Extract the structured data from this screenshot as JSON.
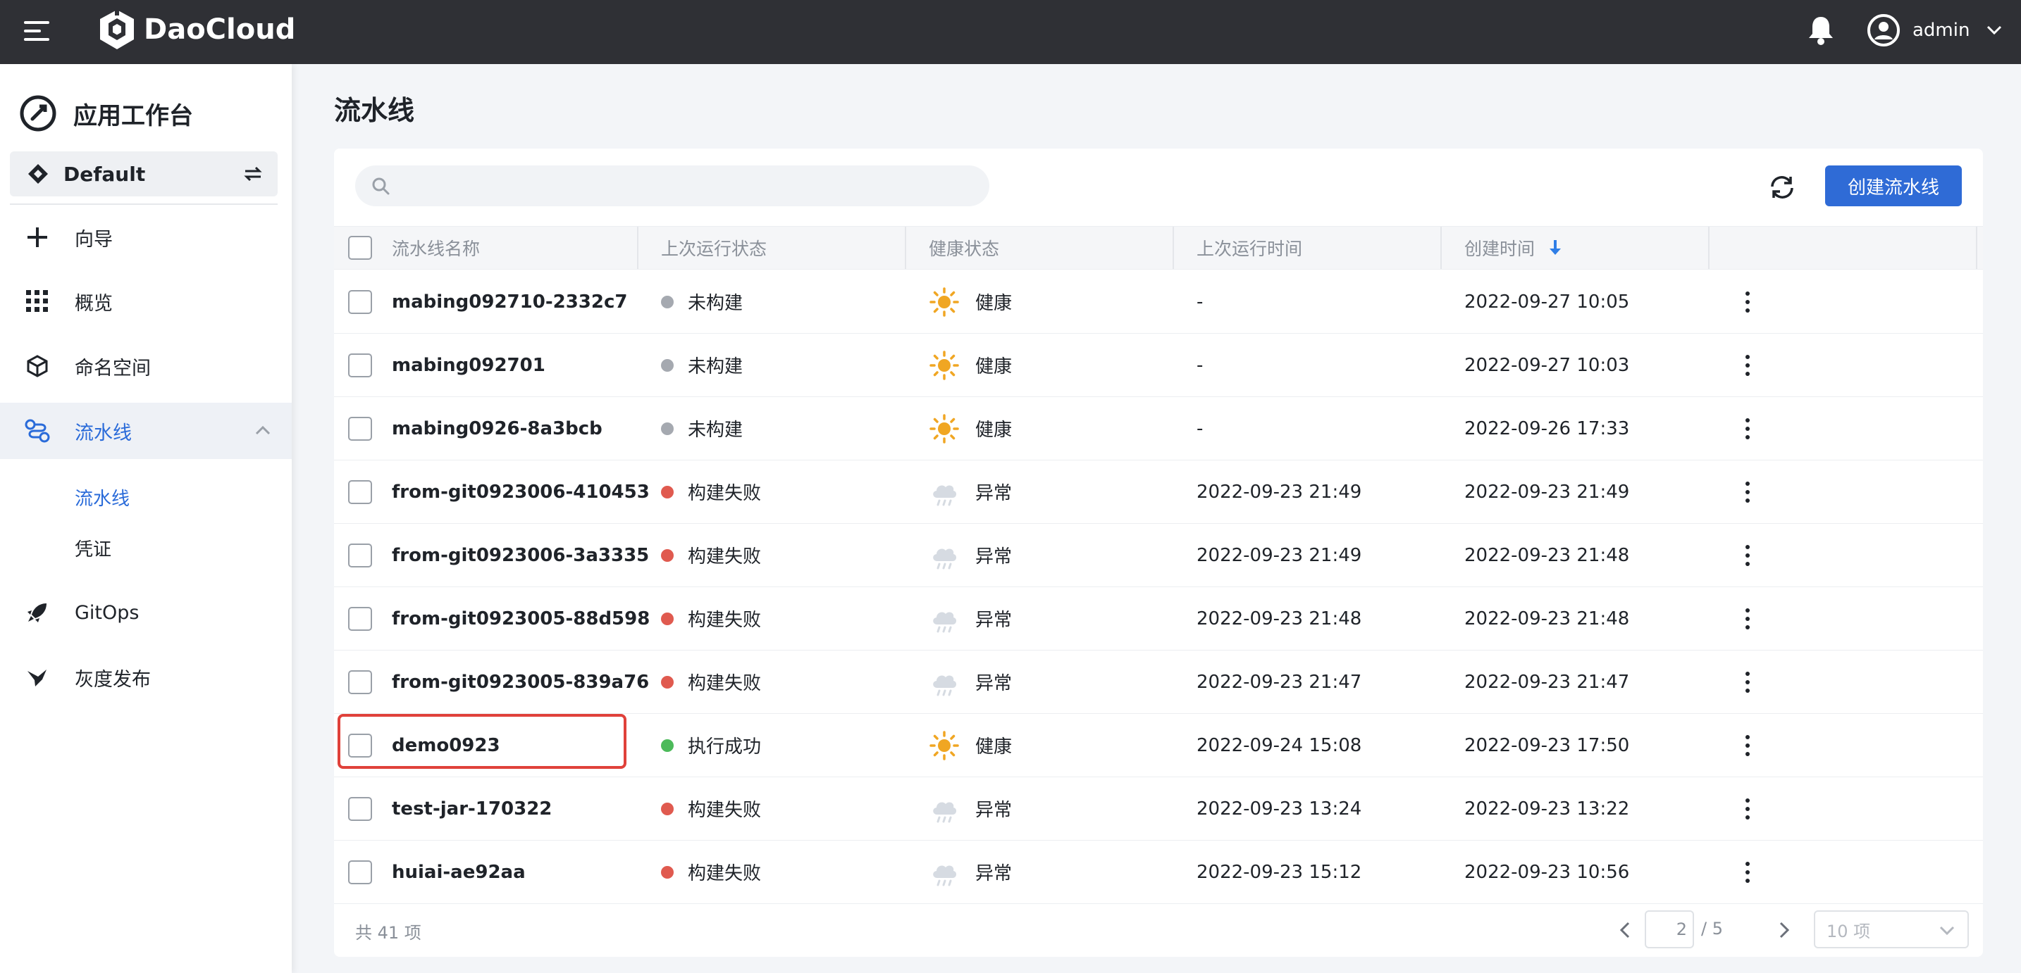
{
  "topbar": {
    "brand": "DaoCloud",
    "user": "admin"
  },
  "sidebar": {
    "app_title": "应用工作台",
    "workspace": "Default",
    "items": [
      {
        "label": "向导",
        "icon": "plus-icon"
      },
      {
        "label": "概览",
        "icon": "grid-icon"
      },
      {
        "label": "命名空间",
        "icon": "cube-icon"
      },
      {
        "label": "流水线",
        "icon": "pipeline-icon",
        "active": true
      },
      {
        "label": "GitOps",
        "icon": "rocket-icon"
      },
      {
        "label": "灰度发布",
        "icon": "bird-icon"
      }
    ],
    "sub_items": [
      {
        "label": "流水线",
        "active": true
      },
      {
        "label": "凭证"
      }
    ]
  },
  "page": {
    "title": "流水线",
    "search_placeholder": "",
    "create_button": "创建流水线"
  },
  "table": {
    "columns": [
      "流水线名称",
      "上次运行状态",
      "健康状态",
      "上次运行时间",
      "创建时间"
    ],
    "rows": [
      {
        "name": "mabing092710-2332c7",
        "status": "未构建",
        "status_color": "#a5a9b0",
        "health": "健康",
        "health_icon": "sun-icon",
        "last_run": "-",
        "created": "2022-09-27 10:05"
      },
      {
        "name": "mabing092701",
        "status": "未构建",
        "status_color": "#a5a9b0",
        "health": "健康",
        "health_icon": "sun-icon",
        "last_run": "-",
        "created": "2022-09-27 10:03"
      },
      {
        "name": "mabing0926-8a3bcb",
        "status": "未构建",
        "status_color": "#a5a9b0",
        "health": "健康",
        "health_icon": "sun-icon",
        "last_run": "-",
        "created": "2022-09-26 17:33"
      },
      {
        "name": "from-git0923006-410453",
        "status": "构建失败",
        "status_color": "#e05a4f",
        "health": "异常",
        "health_icon": "cloud-icon",
        "last_run": "2022-09-23 21:49",
        "created": "2022-09-23 21:49"
      },
      {
        "name": "from-git0923006-3a3335",
        "status": "构建失败",
        "status_color": "#e05a4f",
        "health": "异常",
        "health_icon": "cloud-icon",
        "last_run": "2022-09-23 21:49",
        "created": "2022-09-23 21:48"
      },
      {
        "name": "from-git0923005-88d598",
        "status": "构建失败",
        "status_color": "#e05a4f",
        "health": "异常",
        "health_icon": "cloud-icon",
        "last_run": "2022-09-23 21:48",
        "created": "2022-09-23 21:48"
      },
      {
        "name": "from-git0923005-839a76",
        "status": "构建失败",
        "status_color": "#e05a4f",
        "health": "异常",
        "health_icon": "cloud-icon",
        "last_run": "2022-09-23 21:47",
        "created": "2022-09-23 21:47"
      },
      {
        "name": "demo0923",
        "status": "执行成功",
        "status_color": "#4cba5a",
        "health": "健康",
        "health_icon": "sun-icon",
        "last_run": "2022-09-24 15:08",
        "created": "2022-09-23 17:50"
      },
      {
        "name": "test-jar-170322",
        "status": "构建失败",
        "status_color": "#e05a4f",
        "health": "异常",
        "health_icon": "cloud-icon",
        "last_run": "2022-09-23 13:24",
        "created": "2022-09-23 13:22"
      },
      {
        "name": "huiai-ae92aa",
        "status": "构建失败",
        "status_color": "#e05a4f",
        "health": "异常",
        "health_icon": "cloud-icon",
        "last_run": "2022-09-23 15:12",
        "created": "2022-09-23 10:56"
      }
    ]
  },
  "footer": {
    "total": "共 41 项",
    "current_page": "2",
    "page_total": "/ 5",
    "page_size": "10 项"
  },
  "colors": {
    "accent": "#2f6bd6",
    "highlight": "#e0413a",
    "topbar": "#2f3035"
  }
}
